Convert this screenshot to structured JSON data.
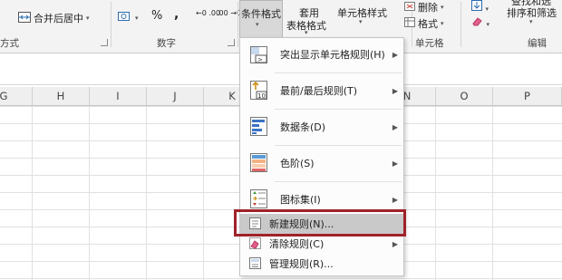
{
  "ribbon": {
    "alignment_group_label": "方式",
    "merge_center_label": "合并后居中",
    "number_group_label": "数字",
    "percent_symbol": "%",
    "comma_symbol": ",",
    "decimal_increase": "←0 .00",
    "decimal_decrease": ".00 →0",
    "conditional_format_label": "条件格式",
    "table_format_label_1": "套用",
    "table_format_label_2": "表格格式",
    "cell_style_label": "单元格样式",
    "delete_label": "删除",
    "format_label": "格式",
    "cells_group_label": "单元格",
    "sort_filter_label": "排序和筛选",
    "find_select_label": "查找和选",
    "editing_group_label": "编辑"
  },
  "columns": [
    "G",
    "H",
    "I",
    "J",
    "K",
    "N",
    "O",
    "P"
  ],
  "menu": {
    "items": [
      {
        "label": "突出显示单元格规则(H)",
        "has_submenu": true
      },
      {
        "label": "最前/最后规则(T)",
        "has_submenu": true
      },
      {
        "label": "数据条(D)",
        "has_submenu": true
      },
      {
        "label": "色阶(S)",
        "has_submenu": true
      },
      {
        "label": "图标集(I)",
        "has_submenu": true
      },
      {
        "label": "新建规则(N)...",
        "has_submenu": false,
        "selected": true
      },
      {
        "label": "清除规则(C)",
        "has_submenu": true
      },
      {
        "label": "管理规则(R)...",
        "has_submenu": false
      }
    ],
    "icon_text_top10": "10"
  },
  "colors": {
    "highlight_border": "#a02229",
    "selected_item_bg": "#c9c9c9",
    "ribbon_bg": "#f3f3f3"
  }
}
